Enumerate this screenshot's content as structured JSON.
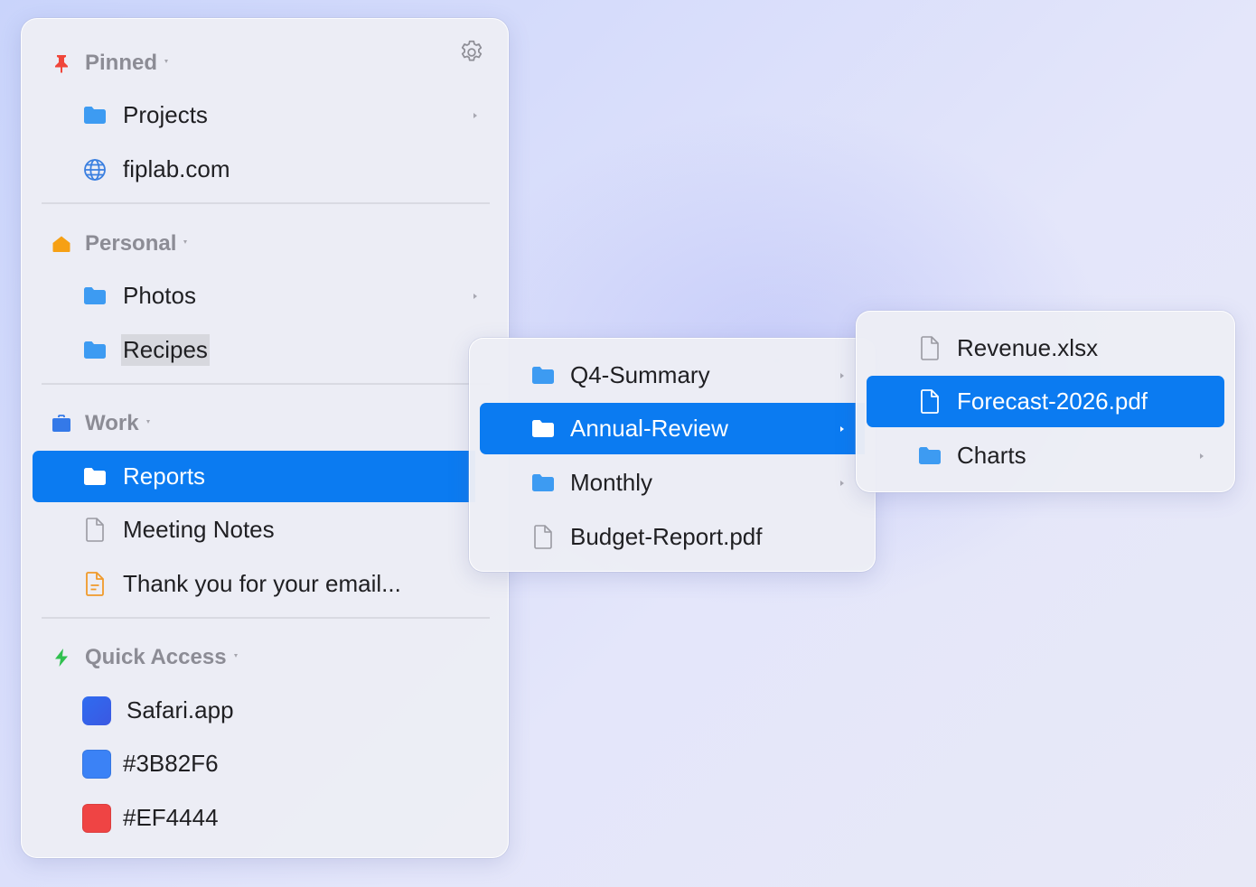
{
  "colors": {
    "accent": "#0B7BF1",
    "folder": "#3D9BF2",
    "pin": "#F0463A",
    "home": "#F6A014",
    "briefcase": "#3479E8",
    "bolt": "#30C04F",
    "note_file": "#F09A2A"
  },
  "sidebar": {
    "sections": [
      {
        "title": "Pinned",
        "icon": "pin-icon"
      },
      {
        "title": "Personal",
        "icon": "home-icon"
      },
      {
        "title": "Work",
        "icon": "briefcase-icon"
      },
      {
        "title": "Quick Access",
        "icon": "bolt-icon"
      }
    ],
    "pinned": [
      {
        "label": "Projects",
        "icon": "folder-icon"
      },
      {
        "label": "fiplab.com",
        "icon": "globe-icon"
      }
    ],
    "personal": [
      {
        "label": "Photos",
        "icon": "folder-icon"
      },
      {
        "label": "Recipes",
        "icon": "folder-icon"
      }
    ],
    "work": [
      {
        "label": "Reports",
        "icon": "folder-icon",
        "selected": true
      },
      {
        "label": "Meeting Notes",
        "icon": "document-icon"
      },
      {
        "label": "Thank you for your email...",
        "icon": "note-document-icon"
      }
    ],
    "quick_access": [
      {
        "label": "Safari.app",
        "icon": "app-icon",
        "color": "#3360E8"
      },
      {
        "label": "#3B82F6",
        "icon": "color-swatch-icon",
        "color": "#3B82F6"
      },
      {
        "label": "#EF4444",
        "icon": "color-swatch-icon",
        "color": "#EF4444"
      }
    ]
  },
  "submenu_reports": [
    {
      "label": "Q4-Summary",
      "icon": "folder-icon"
    },
    {
      "label": "Annual-Review",
      "icon": "folder-icon",
      "selected": true
    },
    {
      "label": "Monthly",
      "icon": "folder-icon"
    },
    {
      "label": "Budget-Report.pdf",
      "icon": "document-icon"
    }
  ],
  "submenu_annual_review": [
    {
      "label": "Revenue.xlsx",
      "icon": "document-icon"
    },
    {
      "label": "Forecast-2026.pdf",
      "icon": "document-icon",
      "selected": true
    },
    {
      "label": "Charts",
      "icon": "folder-icon"
    }
  ]
}
